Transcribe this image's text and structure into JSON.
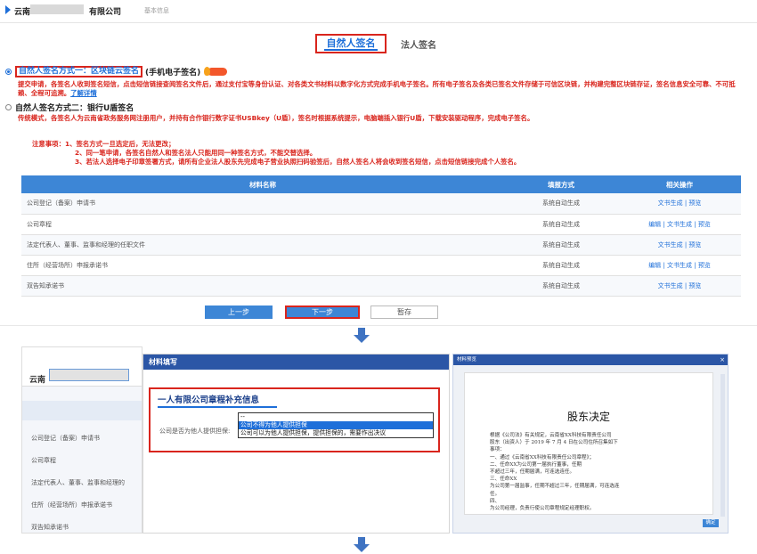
{
  "header": {
    "company_a": "云南",
    "company_b": "有限公司",
    "subtitle": "基本信息"
  },
  "tabs": {
    "natural": "自然人签名",
    "legal": "法人签名"
  },
  "option1": {
    "label": "自然人签名方式一：区块链云签名",
    "suffix": "(手机电子签名)",
    "desc": "提交申请，各签名人收到签名短信，点击短信链接查阅签名文件后，通过支付宝等身份认证、对各类文书材料以数字化方式完成手机电子签名。所有电子签名及各类已签名文件存储于可信区块链，并构建完整区块链存证，签名信息安全可靠、不可抵赖、全程可追溯。",
    "more": "了解详情"
  },
  "option2": {
    "label": "自然人签名方式二：银行U盾签名",
    "desc": "传统模式，各签名人为云南省政务服务网注册用户，并持有合作银行数字证书USBkey（U盾），签名时根据系统提示，电脑端插入银行U盾，下载安装驱动程序，完成电子签名。"
  },
  "notes": {
    "title": "注意事项：1、签名方式一旦选定后，无法更改；",
    "n2": "2、同一笔申请，各签名自然人和签名法人只能用同一种签名方式，不能交替选择。",
    "n3": "3、若法人选择电子印章签署方式，请所有企业法人股东先完成电子营业执照扫码验签后，自然人签名人将会收到签名短信，点击短信链接完成个人签名。"
  },
  "table": {
    "headers": [
      "材料名称",
      "填报方式",
      "相关操作"
    ],
    "rows": [
      {
        "name": "公司登记（备案）申请书",
        "mode": "系统自动生成",
        "edit": "",
        "gen": "文书生成",
        "preview": "预览"
      },
      {
        "name": "公司章程",
        "mode": "系统自动生成",
        "edit": "编辑",
        "gen": "文书生成",
        "preview": "预览"
      },
      {
        "name": "法定代表人、董事、监事和经理的任职文件",
        "mode": "系统自动生成",
        "edit": "",
        "gen": "文书生成",
        "preview": "预览"
      },
      {
        "name": "住所（经营场所）申报承诺书",
        "mode": "系统自动生成",
        "edit": "编辑",
        "gen": "文书生成",
        "preview": "预览"
      },
      {
        "name": "双告知承诺书",
        "mode": "系统自动生成",
        "edit": "",
        "gen": "文书生成",
        "preview": "预览"
      }
    ]
  },
  "buttons": {
    "prev": "上一步",
    "next": "下一步",
    "save": "暂存"
  },
  "left_panel": {
    "title": "云南",
    "items": [
      "公司登记（备案）申请书",
      "公司章程",
      "法定代表人、董事、监事和经理的",
      "住所（经营场所）申报承诺书",
      "双告知承诺书"
    ]
  },
  "mid_panel": {
    "header": "材料填写",
    "title": "一人有限公司章程补充信息",
    "label": "公司是否为他人提供担保:",
    "options": [
      "--",
      "公司不得为他人提供担保",
      "公司可以为他人提供担保，提供担保的，需要作出决议"
    ],
    "selected": 1
  },
  "right_panel": {
    "header": "材料预览",
    "close": "×",
    "doc_title": "股东决定",
    "lines": [
      "根据《公司法》有关规定，云南省XX科技有限责任公司",
      "股东（出资人）于 2019 年 7 月 4 日在公司住所召集如下",
      "事项：",
      "一、通过《云南省XX科技有限责任公司章程》；",
      "二、任命XX为公司第一届执行董事，任期",
      "不超过三年，任期届满，可连选连任。",
      "三、任命XX",
      "为公司第一届监事，任期不超过三年，任期届满，可连选连",
      "任。",
      "四、",
      "为公司经理，负责行使公司章程规定经理职权。"
    ],
    "ok": "确定"
  }
}
